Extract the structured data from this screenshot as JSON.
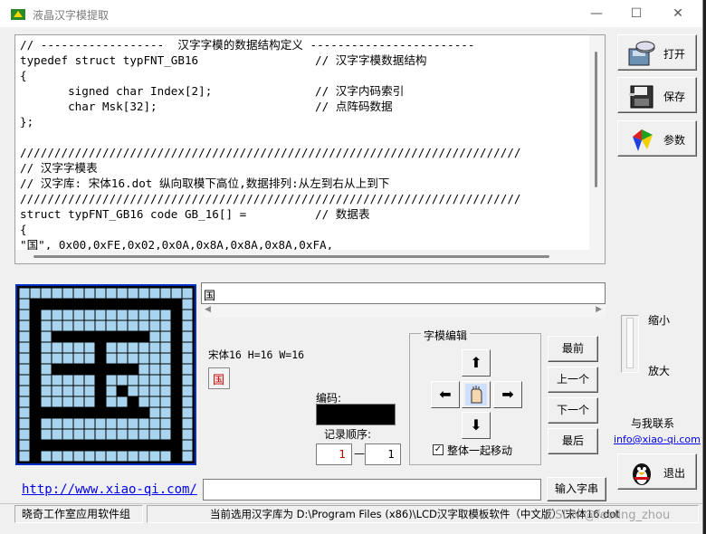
{
  "window": {
    "title": "液晶汉字模提取",
    "minimize": "—",
    "maximize": "☐",
    "close": "✕"
  },
  "code_lines": [
    "// ------------------  汉字字模的数据结构定义 ------------------------",
    "typedef struct typFNT_GB16                 // 汉字字模数据结构",
    "{",
    "       signed char Index[2];               // 汉字内码索引",
    "       char Msk[32];                       // 点阵码数据",
    "};",
    "",
    "/////////////////////////////////////////////////////////////////////////",
    "// 汉字字模表",
    "// 汉字库: 宋体16.dot 纵向取模下高位,数据排列:从左到右从上到下",
    "/////////////////////////////////////////////////////////////////////////",
    "struct typFNT_GB16 code GB_16[] =          // 数据表",
    "{",
    "\"国\", 0x00,0xFE,0x02,0x0A,0x8A,0x8A,0x8A,0xFA,"
  ],
  "right_buttons": [
    {
      "label": "打开",
      "icon": "open-disk-icon"
    },
    {
      "label": "保存",
      "icon": "save-disk-icon"
    },
    {
      "label": "参数",
      "icon": "palette-icon"
    }
  ],
  "input_text": "国",
  "font_info": "宋体16 H=16 W=16",
  "char_preview": "国",
  "code_label": "编码:",
  "record_order_label": "记录顺序:",
  "record_index": "1",
  "record_total": "1",
  "record_dash": "—",
  "edit_group_label": "字模编辑",
  "move_together_label": "整体一起移动",
  "move_together_checked": true,
  "arrows": {
    "up": "⬆",
    "down": "⬇",
    "left": "⬅",
    "right": "➡"
  },
  "nav_buttons": [
    "最前",
    "上一个",
    "下一个",
    "最后"
  ],
  "zoom": {
    "small": "缩小",
    "large": "放大"
  },
  "contact": {
    "label": "与我联系",
    "email": "info@xiao-qi.com"
  },
  "exit_label": "退出",
  "website": "http://www.xiao-qi.com/",
  "input_string_button": "输入字串",
  "status_left": "晓奇工作室应用软件组",
  "status_right": "当前选用汉字库为 D:\\Program Files (x86)\\LCD汉字取模板软件（中文版）\\宋体16.dot",
  "watermark": "CSDN @feeling_zhou",
  "bitmap_rows": [
    "0000000000000000",
    "0111111111111110",
    "0100000000000010",
    "0100000000000010",
    "0101111111110010",
    "0100000100000010",
    "0100000100000010",
    "0101111111100010",
    "0100000100000010",
    "0100000101000010",
    "0100000100100010",
    "0111111111110010",
    "0100000000000010",
    "0100000000000010",
    "0111111111111110",
    "0100000000000010"
  ]
}
